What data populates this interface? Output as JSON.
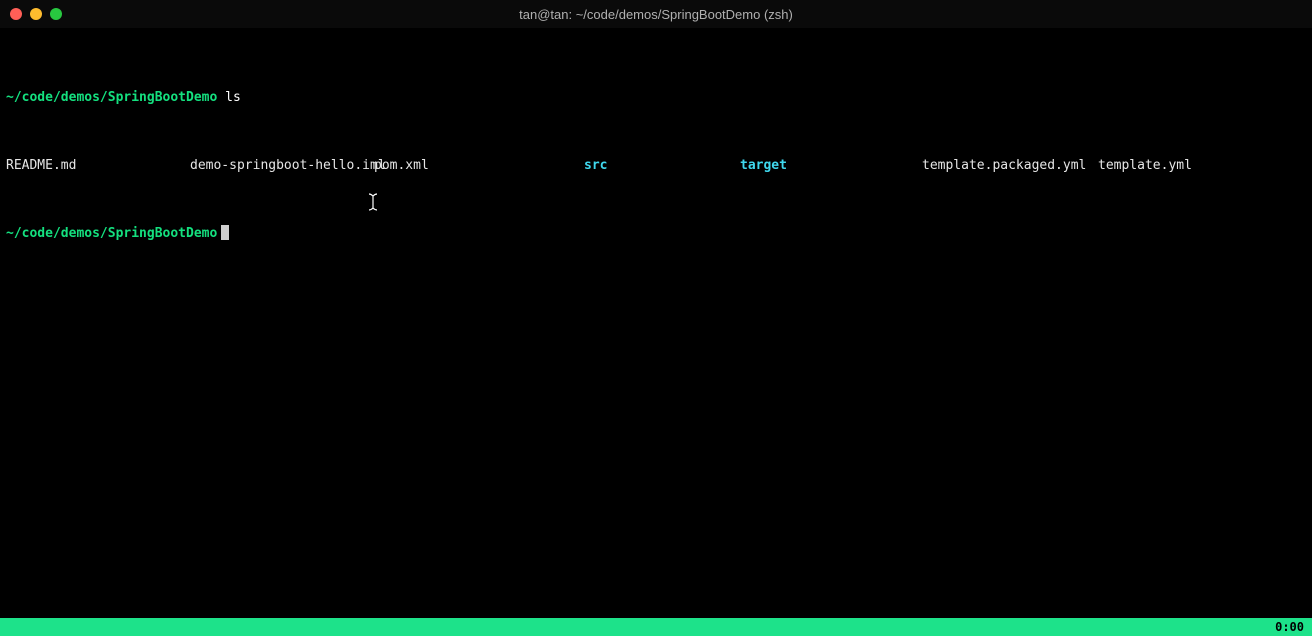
{
  "window": {
    "title": "tan@tan: ~/code/demos/SpringBootDemo (zsh)"
  },
  "prompt1": {
    "path": "~/code/demos/SpringBootDemo",
    "command": "ls"
  },
  "ls_output": {
    "col1": "README.md",
    "col2": "demo-springboot-hello.iml",
    "col3": "pom.xml",
    "col4": "src",
    "col5": "target",
    "col6": "template.packaged.yml",
    "col7": "template.yml"
  },
  "prompt2": {
    "path": "~/code/demos/SpringBootDemo"
  },
  "statusbar": {
    "right": "0:00"
  }
}
